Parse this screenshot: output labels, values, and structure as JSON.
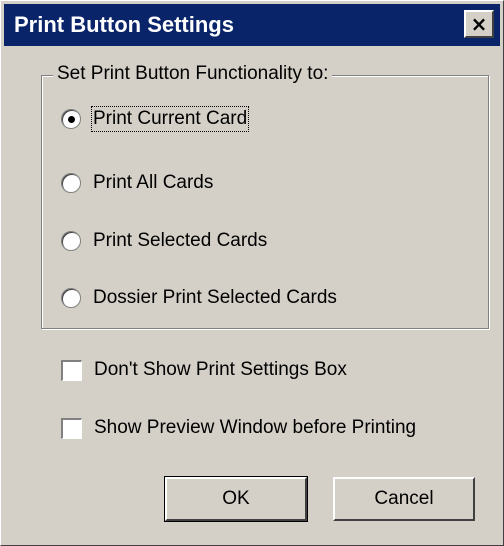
{
  "window": {
    "title": "Print Button Settings",
    "close_glyph": "×"
  },
  "group": {
    "legend": "Set Print Button Functionality to:",
    "options": [
      {
        "label": "Print Current Card",
        "checked": true
      },
      {
        "label": "Print All Cards",
        "checked": false
      },
      {
        "label": "Print Selected Cards",
        "checked": false
      },
      {
        "label": "Dossier Print Selected Cards",
        "checked": false
      }
    ]
  },
  "checkboxes": [
    {
      "label": "Don't Show Print Settings Box",
      "checked": false
    },
    {
      "label": "Show Preview Window before Printing",
      "checked": false
    }
  ],
  "buttons": {
    "ok": "OK",
    "cancel": "Cancel"
  },
  "colors": {
    "titlebar": "#0a246a",
    "face": "#d4d0c8"
  }
}
